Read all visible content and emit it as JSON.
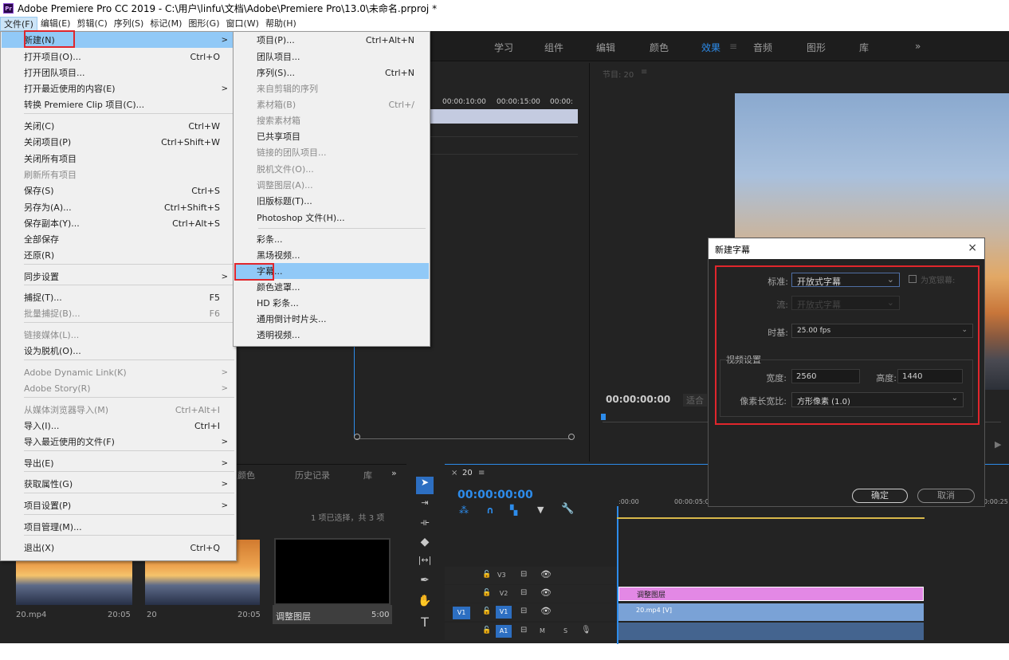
{
  "window": {
    "app_icon": "Pr",
    "title": "Adobe Premiere Pro CC 2019 - C:\\用户\\linfu\\文档\\Adobe\\Premiere Pro\\13.0\\未命名.prproj *"
  },
  "menubar": [
    "文件(F)",
    "编辑(E)",
    "剪辑(C)",
    "序列(S)",
    "标记(M)",
    "图形(G)",
    "窗口(W)",
    "帮助(H)"
  ],
  "workspaces": [
    "学习",
    "组件",
    "编辑",
    "颜色",
    "效果",
    "≡",
    "音频",
    "图形",
    "库",
    "»"
  ],
  "file_menu": [
    {
      "label": "新建(N)",
      "shortcut": "",
      "arrow": ">",
      "disabled": false
    },
    {
      "label": "打开项目(O)...",
      "shortcut": "Ctrl+O",
      "arrow": "",
      "disabled": false
    },
    {
      "label": "打开团队项目...",
      "shortcut": "",
      "arrow": "",
      "disabled": false
    },
    {
      "label": "打开最近使用的内容(E)",
      "shortcut": "",
      "arrow": ">",
      "disabled": false
    },
    {
      "label": "转换 Premiere Clip 项目(C)...",
      "shortcut": "",
      "arrow": "",
      "disabled": false
    },
    {
      "label": "关闭(C)",
      "shortcut": "Ctrl+W",
      "arrow": "",
      "disabled": false
    },
    {
      "label": "关闭项目(P)",
      "shortcut": "Ctrl+Shift+W",
      "arrow": "",
      "disabled": false
    },
    {
      "label": "关闭所有项目",
      "shortcut": "",
      "arrow": "",
      "disabled": false
    },
    {
      "label": "刷新所有项目",
      "shortcut": "",
      "arrow": "",
      "disabled": true
    },
    {
      "label": "保存(S)",
      "shortcut": "Ctrl+S",
      "arrow": "",
      "disabled": false
    },
    {
      "label": "另存为(A)...",
      "shortcut": "Ctrl+Shift+S",
      "arrow": "",
      "disabled": false
    },
    {
      "label": "保存副本(Y)...",
      "shortcut": "Ctrl+Alt+S",
      "arrow": "",
      "disabled": false
    },
    {
      "label": "全部保存",
      "shortcut": "",
      "arrow": "",
      "disabled": false
    },
    {
      "label": "还原(R)",
      "shortcut": "",
      "arrow": "",
      "disabled": false
    },
    {
      "label": "同步设置",
      "shortcut": "",
      "arrow": ">",
      "disabled": false
    },
    {
      "label": "捕捉(T)...",
      "shortcut": "F5",
      "arrow": "",
      "disabled": false
    },
    {
      "label": "批量捕捉(B)...",
      "shortcut": "F6",
      "arrow": "",
      "disabled": true
    },
    {
      "label": "链接媒体(L)...",
      "shortcut": "",
      "arrow": "",
      "disabled": true
    },
    {
      "label": "设为脱机(O)...",
      "shortcut": "",
      "arrow": "",
      "disabled": false
    },
    {
      "label": "Adobe Dynamic Link(K)",
      "shortcut": "",
      "arrow": ">",
      "disabled": true
    },
    {
      "label": "Adobe Story(R)",
      "shortcut": "",
      "arrow": ">",
      "disabled": true
    },
    {
      "label": "从媒体浏览器导入(M)",
      "shortcut": "Ctrl+Alt+I",
      "arrow": "",
      "disabled": true
    },
    {
      "label": "导入(I)...",
      "shortcut": "Ctrl+I",
      "arrow": "",
      "disabled": false
    },
    {
      "label": "导入最近使用的文件(F)",
      "shortcut": "",
      "arrow": ">",
      "disabled": false
    },
    {
      "label": "导出(E)",
      "shortcut": "",
      "arrow": ">",
      "disabled": false
    },
    {
      "label": "获取属性(G)",
      "shortcut": "",
      "arrow": ">",
      "disabled": false
    },
    {
      "label": "项目设置(P)",
      "shortcut": "",
      "arrow": ">",
      "disabled": false
    },
    {
      "label": "项目管理(M)...",
      "shortcut": "",
      "arrow": "",
      "disabled": false
    },
    {
      "label": "退出(X)",
      "shortcut": "Ctrl+Q",
      "arrow": "",
      "disabled": false
    }
  ],
  "new_submenu": [
    {
      "label": "项目(P)...",
      "shortcut": "Ctrl+Alt+N",
      "disabled": false
    },
    {
      "label": "团队项目...",
      "shortcut": "",
      "disabled": false
    },
    {
      "label": "序列(S)...",
      "shortcut": "Ctrl+N",
      "disabled": false
    },
    {
      "label": "来自剪辑的序列",
      "shortcut": "",
      "disabled": true
    },
    {
      "label": "素材箱(B)",
      "shortcut": "Ctrl+/",
      "disabled": true
    },
    {
      "label": "搜索素材箱",
      "shortcut": "",
      "disabled": true
    },
    {
      "label": "已共享项目",
      "shortcut": "",
      "disabled": false
    },
    {
      "label": "链接的团队项目...",
      "shortcut": "",
      "disabled": true
    },
    {
      "label": "脱机文件(O)...",
      "shortcut": "",
      "disabled": true
    },
    {
      "label": "调整图层(A)...",
      "shortcut": "",
      "disabled": true
    },
    {
      "label": "旧版标题(T)...",
      "shortcut": "",
      "disabled": false
    },
    {
      "label": "Photoshop 文件(H)...",
      "shortcut": "",
      "disabled": false
    },
    {
      "label": "彩条...",
      "shortcut": "",
      "disabled": false
    },
    {
      "label": "黑场视频...",
      "shortcut": "",
      "disabled": false
    },
    {
      "label": "字幕...",
      "shortcut": "",
      "disabled": false
    },
    {
      "label": "颜色遮罩...",
      "shortcut": "",
      "disabled": false
    },
    {
      "label": "HD 彩条...",
      "shortcut": "",
      "disabled": false
    },
    {
      "label": "通用倒计时片头...",
      "shortcut": "",
      "disabled": false
    },
    {
      "label": "透明视频...",
      "shortcut": "",
      "disabled": false
    }
  ],
  "source_panel": {
    "timecodes": [
      "00:00:10:00",
      "00:00:15:00",
      "00:00:"
    ]
  },
  "program_monitor": {
    "title": "节目: 20",
    "menu": "≡",
    "timecode": "00:00:00:00",
    "fit": "适合"
  },
  "project_panel": {
    "tabs": [
      "颜色",
      "历史记录",
      "库",
      "»"
    ],
    "selection_info": "1 项已选择，共 3 项",
    "items": [
      {
        "name": "20.mp4",
        "duration": "20:05"
      },
      {
        "name": "20",
        "duration": "20:05"
      },
      {
        "name": "调整图层",
        "duration": "5:00"
      }
    ]
  },
  "timeline": {
    "tab": "20",
    "close": "×",
    "menu": "≡",
    "timecode": "00:00:00:00",
    "ruler": [
      ":00:00",
      "00:00:05:0",
      "0:00:25"
    ],
    "tracks": [
      {
        "name": "V3",
        "source": ""
      },
      {
        "name": "V2",
        "source": ""
      },
      {
        "name": "V1",
        "source": "V1"
      },
      {
        "name": "A1",
        "source": "",
        "m": "M",
        "s": "S"
      }
    ],
    "clips": {
      "v2": "调整图层",
      "v1": "20.mp4 [V]"
    }
  },
  "dialog": {
    "title": "新建字幕",
    "close": "×",
    "standard_label": "标准:",
    "standard_value": "开放式字幕",
    "checkbox_label": "为宽银幕:",
    "stream_label": "流:",
    "stream_value": "开放式字幕",
    "timebase_label": "时基:",
    "timebase_value": "25.00 fps",
    "video_settings": "视频设置",
    "width_label": "宽度:",
    "width_value": "2560",
    "height_label": "高度:",
    "height_value": "1440",
    "par_label": "像素长宽比:",
    "par_value": "方形像素 (1.0)",
    "ok": "确定",
    "cancel": "取消"
  },
  "colors": {
    "accent": "#2d8ceb",
    "highlight": "#91c9f7",
    "annotation": "#e0262c",
    "adjustment_clip": "#e388e5",
    "video_clip": "#7aa2d6",
    "audio_clip": "#44648f"
  }
}
